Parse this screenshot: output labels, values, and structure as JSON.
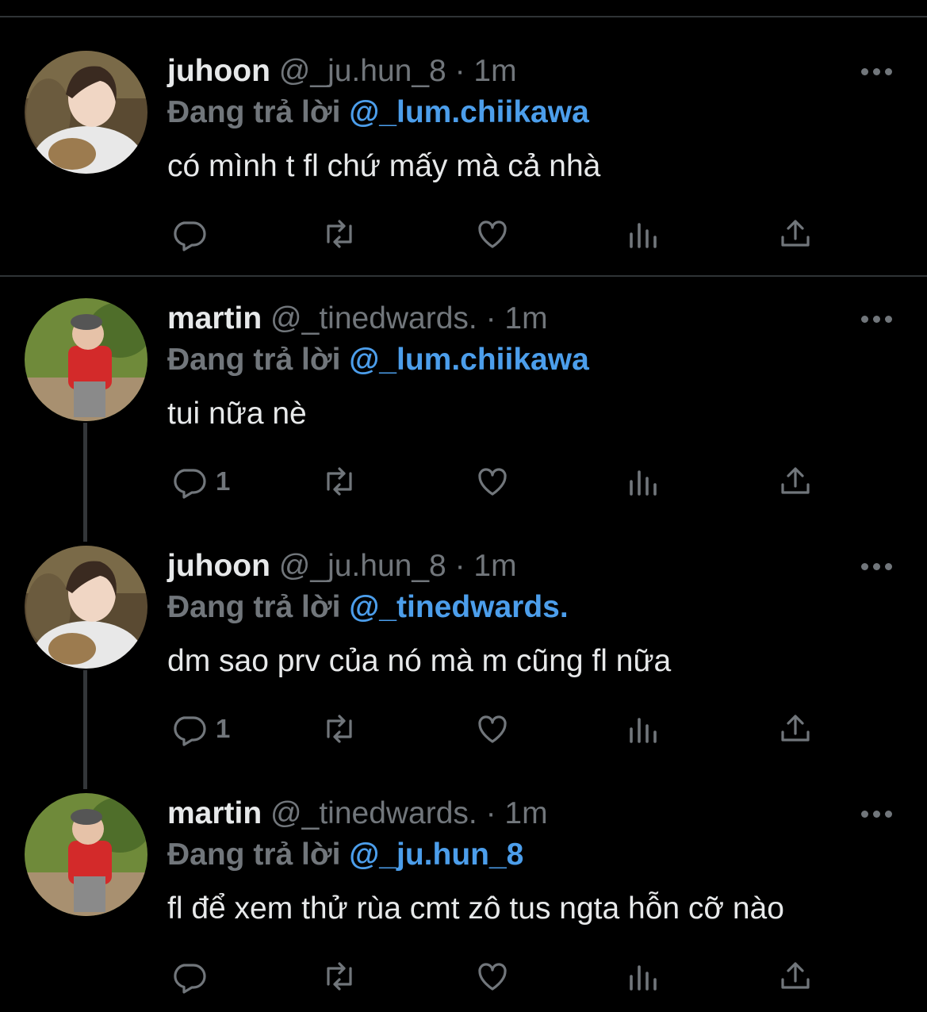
{
  "tweets": [
    {
      "name": "juhoon",
      "handle": "@_ju.hun_8",
      "time": "· 1m",
      "reply_prefix": "Đang trả lời",
      "reply_to": "@_lum.chiikawa",
      "text": "có mình t fl chứ mấy mà cả nhà",
      "reply_count": ""
    },
    {
      "name": "martin",
      "handle": "@_tinedwards.",
      "time": "· 1m",
      "reply_prefix": "Đang trả lời",
      "reply_to": "@_lum.chiikawa",
      "text": "tui nữa nè",
      "reply_count": "1"
    },
    {
      "name": "juhoon",
      "handle": "@_ju.hun_8",
      "time": "· 1m",
      "reply_prefix": "Đang trả lời",
      "reply_to": "@_tinedwards.",
      "text": "dm sao prv của nó mà m cũng fl nữa",
      "reply_count": "1"
    },
    {
      "name": "martin",
      "handle": "@_tinedwards.",
      "time": "· 1m",
      "reply_prefix": "Đang trả lời",
      "reply_to": "@_ju.hun_8",
      "text": "fl để xem thử rùa cmt zô tus ngta hỗn cỡ nào",
      "reply_count": ""
    }
  ],
  "icons": {
    "avatar_juhoon": "avatar-photo",
    "avatar_martin": "avatar-photo",
    "actions": [
      "reply-icon",
      "retweet-icon",
      "like-icon",
      "views-icon",
      "share-icon"
    ],
    "more": "more-options-icon"
  },
  "colors": {
    "background": "#000000",
    "text": "#e7e9ea",
    "muted": "#71767b",
    "link": "#4c9eeb",
    "divider": "#2f3336"
  }
}
